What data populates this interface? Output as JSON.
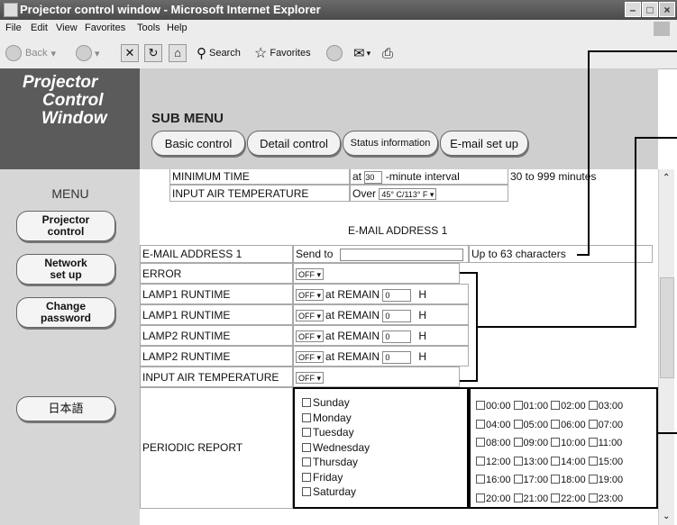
{
  "window": {
    "title": "Projector control window - Microsoft Internet Explorer",
    "min": "–",
    "max": "□",
    "close": "×"
  },
  "menubar": [
    "File",
    "Edit",
    "View",
    "Favorites",
    "Tools",
    "Help"
  ],
  "toolbar": {
    "back": "Back",
    "search": "Search",
    "favorites": "Favorites"
  },
  "brand": {
    "line1": "Projector",
    "line2": "Control",
    "line3": "Window"
  },
  "submenu": {
    "title": "SUB MENU",
    "buttons": [
      "Basic control",
      "Detail control",
      "Status information",
      "E-mail set up"
    ]
  },
  "nav": {
    "menu_label": "MENU",
    "projector_control": [
      "Projector",
      "control"
    ],
    "network_setup": [
      "Network",
      "set up"
    ],
    "change_password": [
      "Change",
      "password"
    ],
    "japanese": "日本語"
  },
  "top_rows": {
    "minimum_time": {
      "label": "MINIMUM TIME",
      "at": "at",
      "value": "30",
      "unit": "-minute interval",
      "range": "30 to 999 minutes"
    },
    "input_air_temp": {
      "label": "INPUT AIR TEMPERATURE",
      "over": "Over",
      "select": "45° C/113° F"
    }
  },
  "email_section_title": "E-MAIL ADDRESS 1",
  "email_row": {
    "label": "E-MAIL ADDRESS 1",
    "send_to": "Send to",
    "value": "",
    "hint": "Up to 63 characters"
  },
  "rows": [
    {
      "label": "ERROR",
      "select": "OFF",
      "remain": false
    },
    {
      "label": "LAMP1 RUNTIME",
      "select": "OFF",
      "remain": true,
      "at": "at REMAIN",
      "value": "0",
      "unit": "H"
    },
    {
      "label": "LAMP1 RUNTIME",
      "select": "OFF",
      "remain": true,
      "at": "at REMAIN",
      "value": "0",
      "unit": "H"
    },
    {
      "label": "LAMP2 RUNTIME",
      "select": "OFF",
      "remain": true,
      "at": "at REMAIN",
      "value": "0",
      "unit": "H"
    },
    {
      "label": "LAMP2 RUNTIME",
      "select": "OFF",
      "remain": true,
      "at": "at REMAIN",
      "value": "0",
      "unit": "H"
    },
    {
      "label": "INPUT AIR TEMPERATURE",
      "select": "OFF",
      "remain": false
    }
  ],
  "periodic": {
    "label": "PERIODIC REPORT",
    "days": [
      "Sunday",
      "Monday",
      "Tuesday",
      "Wednesday",
      "Thursday",
      "Friday",
      "Saturday"
    ],
    "times": [
      [
        "00:00",
        "01:00",
        "02:00",
        "03:00"
      ],
      [
        "04:00",
        "05:00",
        "06:00",
        "07:00"
      ],
      [
        "08:00",
        "09:00",
        "10:00",
        "11:00"
      ],
      [
        "12:00",
        "13:00",
        "14:00",
        "15:00"
      ],
      [
        "16:00",
        "17:00",
        "18:00",
        "19:00"
      ],
      [
        "20:00",
        "21:00",
        "22:00",
        "23:00"
      ]
    ]
  }
}
